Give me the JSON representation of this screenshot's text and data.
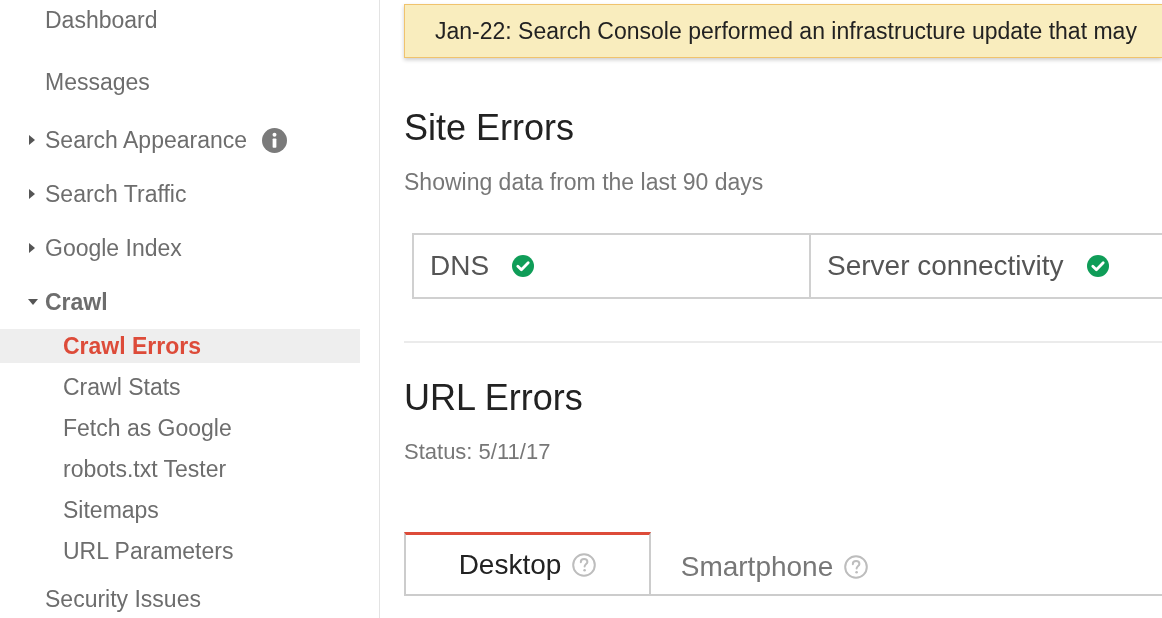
{
  "sidebar": {
    "items": [
      {
        "label": "Dashboard",
        "selected": false
      },
      {
        "label": "Messages",
        "selected": false
      },
      {
        "label": "Search Appearance",
        "selected": false,
        "expanded": false,
        "info": true
      },
      {
        "label": "Search Traffic",
        "selected": false,
        "expanded": false
      },
      {
        "label": "Google Index",
        "selected": false,
        "expanded": false
      },
      {
        "label": "Crawl",
        "selected": false,
        "expanded": true,
        "children": [
          {
            "label": "Crawl Errors",
            "selected": true
          },
          {
            "label": "Crawl Stats",
            "selected": false
          },
          {
            "label": "Fetch as Google",
            "selected": false
          },
          {
            "label": "robots.txt Tester",
            "selected": false
          },
          {
            "label": "Sitemaps",
            "selected": false
          },
          {
            "label": "URL Parameters",
            "selected": false
          }
        ]
      },
      {
        "label": "Security Issues",
        "selected": false
      }
    ]
  },
  "banner": {
    "text": "Jan-22: Search Console performed an infrastructure update that may"
  },
  "site_errors": {
    "title": "Site Errors",
    "subtitle": "Showing data from the last 90 days",
    "checks": [
      {
        "label": "DNS",
        "ok": true
      },
      {
        "label": "Server connectivity",
        "ok": true
      }
    ]
  },
  "url_errors": {
    "title": "URL Errors",
    "status": "Status: 5/11/17",
    "tabs": [
      {
        "label": "Desktop",
        "selected": true
      },
      {
        "label": "Smartphone",
        "selected": false
      }
    ]
  }
}
